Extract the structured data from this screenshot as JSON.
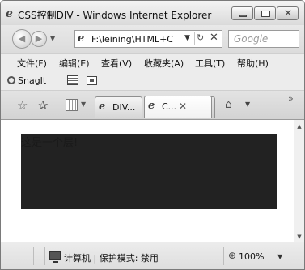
{
  "window": {
    "title": "CSS控制DIV - Windows Internet Explorer"
  },
  "address_bar": {
    "url": "F:\\leining\\HTML+C",
    "search_placeholder": "Google"
  },
  "menu": {
    "items": [
      "文件(F)",
      "编辑(E)",
      "查看(V)",
      "收藏夹(A)",
      "工具(T)",
      "帮助(H)"
    ]
  },
  "snagit": {
    "label": "SnagIt"
  },
  "tabs": [
    {
      "label": "DIV..."
    },
    {
      "label": "C..."
    }
  ],
  "page": {
    "div_text": "这是一个层!",
    "div_background": "#222222"
  },
  "status": {
    "zone": "计算机 | 保护模式: 禁用",
    "zoom": "100%"
  }
}
